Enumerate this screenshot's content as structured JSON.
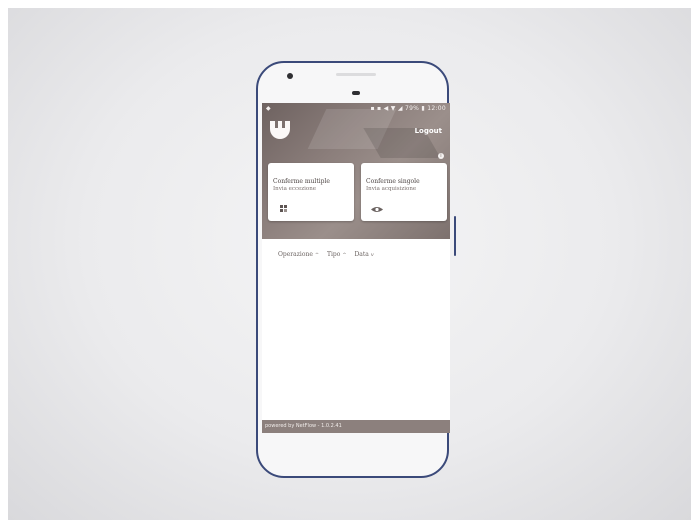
{
  "statusbar": {
    "left": "◆",
    "right": "▪ ▪ ◀ ▼ ◢ 79% ▮ 12:00"
  },
  "header": {
    "logout_label": "Logout",
    "info_glyph": "i"
  },
  "cards": [
    {
      "title": "Conferme multiple",
      "subtitle": "Invia eccezione",
      "icon": "grid-icon"
    },
    {
      "title": "Conferme singole",
      "subtitle": "Invia acquisizione",
      "icon": "eye-icon"
    }
  ],
  "filters": [
    {
      "label": "Operazione",
      "chevron": "^"
    },
    {
      "label": "Tipo",
      "chevron": "^"
    },
    {
      "label": "Data",
      "chevron": "v"
    }
  ],
  "footer": {
    "text": "powered by NetFlow - 1.0.2.41"
  },
  "colors": {
    "phone_frame": "#3b4a7a",
    "hero": "#8a7d7a",
    "footer": "#8c807d"
  }
}
